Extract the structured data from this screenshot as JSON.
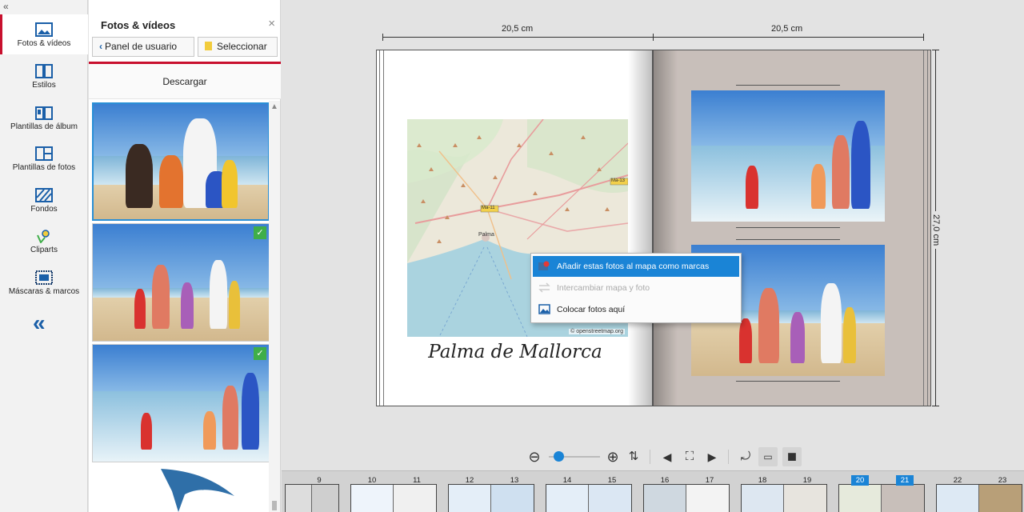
{
  "sidebar": {
    "items": [
      {
        "label": "Fotos & vídeos",
        "icon": "photo-icon",
        "active": true
      },
      {
        "label": "Estilos",
        "icon": "styles-icon"
      },
      {
        "label": "Plantillas de álbum",
        "icon": "album-template-icon"
      },
      {
        "label": "Plantillas de fotos",
        "icon": "photo-template-icon"
      },
      {
        "label": "Fondos",
        "icon": "background-icon"
      },
      {
        "label": "Cliparts",
        "icon": "clipart-icon"
      },
      {
        "label": "Máscaras & marcos",
        "icon": "mask-frame-icon"
      }
    ],
    "collapse_small": "«",
    "collapse_big": "«"
  },
  "panel": {
    "title": "Fotos & vídeos",
    "close": "×",
    "back_button": "Panel de usuario",
    "select_button": "Seleccionar",
    "download_label": "Descargar",
    "thumbnails": [
      {
        "checked": false,
        "selected": true
      },
      {
        "checked": true,
        "selected": false
      },
      {
        "checked": true,
        "selected": false
      }
    ],
    "check_glyph": "✓"
  },
  "book": {
    "width_left": "20,5 cm",
    "width_right": "20,5 cm",
    "height": "27,0 cm",
    "caption": "Palma de Mallorca",
    "map_credit": "© openstreetmap.org",
    "map_labels": [
      "Palma",
      "Ma-11",
      "Ma-13"
    ]
  },
  "context_menu": {
    "items": [
      {
        "label": "Añadir estas fotos al mapa como marcas",
        "state": "highlighted"
      },
      {
        "label": "Intercambiar mapa y foto",
        "state": "disabled"
      },
      {
        "label": "Colocar fotos aquí",
        "state": "normal"
      }
    ]
  },
  "toolbar": {
    "zoom_value": 0.1,
    "zoom_out": "zoom-out-icon",
    "zoom_in": "zoom-in-icon"
  },
  "filmstrip": {
    "pages": [
      "9",
      "10",
      "11",
      "12",
      "13",
      "14",
      "15",
      "16",
      "17",
      "18",
      "19",
      "20",
      "21",
      "22",
      "23"
    ],
    "active_pages": [
      "20",
      "21"
    ]
  },
  "colors": {
    "accent": "#1a84d6",
    "brand_red": "#c8102e",
    "check_green": "#3fae49",
    "right_page": "#c8bfba"
  }
}
